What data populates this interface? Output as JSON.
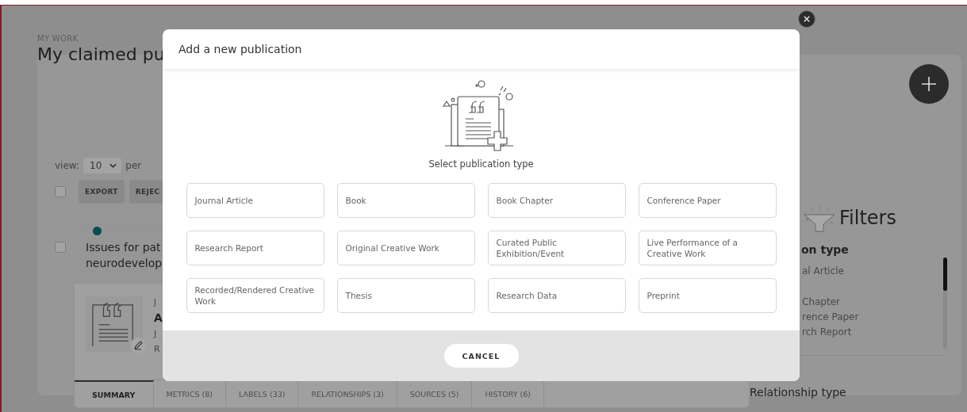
{
  "page": {
    "eyebrow": "MY WORK",
    "title": "My claimed pu",
    "view": {
      "label": "view:",
      "value": "10",
      "suffix": "per"
    },
    "select_all": {
      "checked": false
    },
    "actions": [
      {
        "label": "EXPORT"
      },
      {
        "label": "REJEC"
      }
    ],
    "item": {
      "checked": false,
      "title": "Issues for pat\nneurodevelop",
      "details": [
        {
          "kind": "type",
          "text": "J"
        },
        {
          "kind": "title",
          "text": "A"
        },
        {
          "kind": "meta",
          "text": "J"
        },
        {
          "kind": "meta",
          "text": "R"
        }
      ],
      "tabs": [
        {
          "label": "SUMMARY",
          "selected": true
        },
        {
          "label": "METRICS (8)",
          "selected": false
        },
        {
          "label": "LABELS (33)",
          "selected": false
        },
        {
          "label": "RELATIONSHIPS (3)",
          "selected": false
        },
        {
          "label": "SOURCES (5)",
          "selected": false
        },
        {
          "label": "HISTORY (6)",
          "selected": false
        }
      ]
    },
    "filters": {
      "title": "Filters",
      "sections": [
        {
          "heading": "on type",
          "items": [
            "al Article",
            "Chapter",
            "rence Paper",
            "rch Report"
          ]
        },
        {
          "heading": "Relationship type"
        }
      ]
    }
  },
  "modal": {
    "title": "Add a new publication",
    "prompt": "Select publication type",
    "types": [
      "Journal Article",
      "Book",
      "Book Chapter",
      "Conference Paper",
      "Research Report",
      "Original Creative Work",
      "Curated Public Exhibition/Event",
      "Live Performance of a Creative Work",
      "Recorded/Rendered Creative Work",
      "Thesis",
      "Research Data",
      "Preprint"
    ],
    "cancel": "CANCEL"
  }
}
